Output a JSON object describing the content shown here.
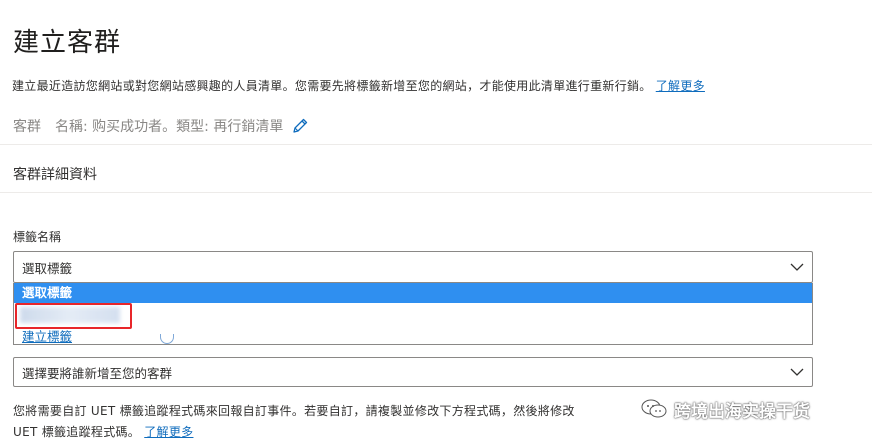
{
  "page": {
    "title": "建立客群",
    "description": "建立最近造訪您網站或對您網站感興趣的人員清單。您需要先將標籤新增至您的網站，才能使用此清單進行重新行銷。",
    "learn_more": "了解更多"
  },
  "audience": {
    "label": "客群",
    "name": "名稱: 购买成功者。",
    "type": "類型: 再行銷清單",
    "edit_icon": "pencil-icon"
  },
  "details": {
    "section_title": "客群詳細資料",
    "tag_field": {
      "label": "標籤名稱",
      "selected_value": "選取標籤",
      "options": [
        {
          "label": "選取標籤",
          "selected": true
        },
        {
          "label": "",
          "blurred": true
        },
        {
          "label": "建立標籤",
          "link": true
        }
      ]
    },
    "who_to_add": {
      "selected_value": "選擇要將誰新增至您的客群"
    },
    "uet_text_line1": "您將需要自訂 UET 標籤追蹤程式碼來回報自訂事件。若要自訂，請複製並修改下方程式碼，然後將修改",
    "uet_text_line2": "UET 標籤追蹤程式碼。",
    "uet_learn_more": "了解更多"
  },
  "watermark": {
    "text": "跨境出海实操干货",
    "icon": "wechat-icon"
  },
  "colors": {
    "link": "#0f6cbd",
    "selected_option": "#2f8ff0",
    "highlight_box": "#e8262a"
  }
}
